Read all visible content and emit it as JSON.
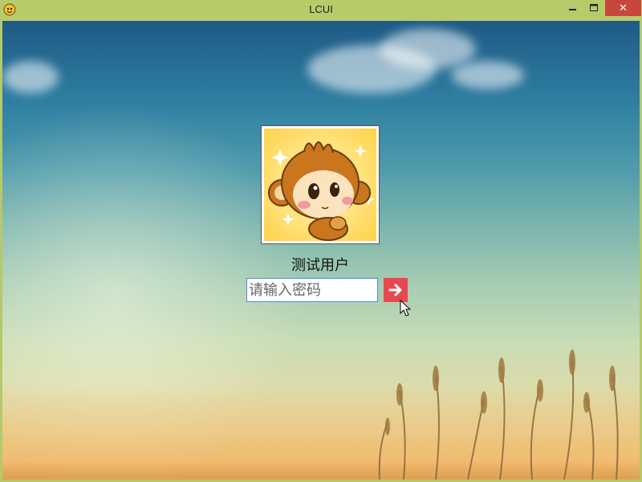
{
  "window": {
    "title": "LCUI",
    "close_glyph": "✕"
  },
  "login": {
    "username": "测试用户",
    "password_placeholder": "请输入密码",
    "password_value": ""
  },
  "icons": {
    "app": "app-monkey-icon",
    "minimize": "minimize-icon",
    "maximize": "maximize-icon",
    "close": "close-icon",
    "submit": "arrow-right-icon",
    "cursor": "mouse-cursor-icon"
  },
  "colors": {
    "titlebar": "#b7cb6b",
    "close_button": "#c7463d",
    "submit_button": "#e8484f",
    "input_border": "#4a90d9"
  }
}
